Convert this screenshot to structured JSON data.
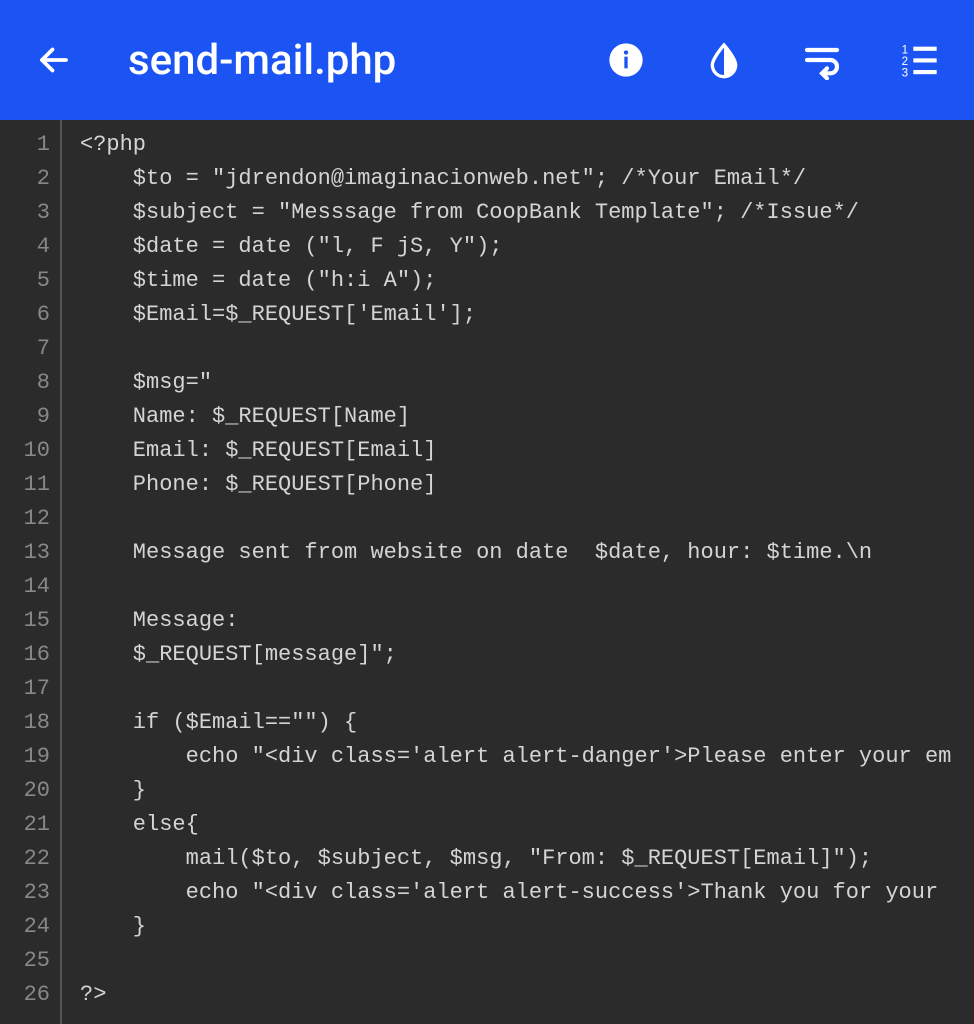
{
  "header": {
    "title": "send-mail.php"
  },
  "code": {
    "lines": [
      "<?php",
      "    $to = \"jdrendon@imaginacionweb.net\"; /*Your Email*/",
      "    $subject = \"Messsage from CoopBank Template\"; /*Issue*/",
      "    $date = date (\"l, F jS, Y\");",
      "    $time = date (\"h:i A\");",
      "    $Email=$_REQUEST['Email'];",
      "",
      "    $msg=\"",
      "    Name: $_REQUEST[Name]",
      "    Email: $_REQUEST[Email]",
      "    Phone: $_REQUEST[Phone]",
      "",
      "    Message sent from website on date  $date, hour: $time.\\n",
      "",
      "    Message:",
      "    $_REQUEST[message]\";",
      "",
      "    if ($Email==\"\") {",
      "        echo \"<div class='alert alert-danger'>Please enter your em",
      "    }",
      "    else{",
      "        mail($to, $subject, $msg, \"From: $_REQUEST[Email]\");",
      "        echo \"<div class='alert alert-success'>Thank you for your ",
      "    }",
      "",
      "?>"
    ]
  }
}
